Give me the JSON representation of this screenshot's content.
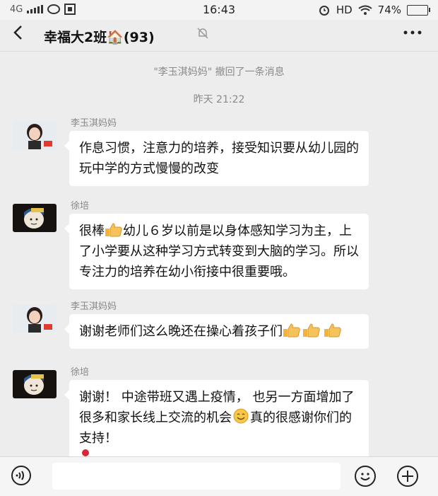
{
  "status_bar": {
    "network": "4G",
    "time": "16:43",
    "hd": "HD",
    "battery_text": "74%",
    "battery_level": 0.74
  },
  "header": {
    "title": "幸福大2班🏠(93)"
  },
  "chat": {
    "recall_notice": "\"李玉淇妈妈\" 撤回了一条消息",
    "timestamp": "昨天 21:22",
    "messages": [
      {
        "sender": "李玉淇妈妈",
        "text": "作息习惯，注意力的培养，接受知识要从幼儿园的玩中学的方式慢慢的改变"
      },
      {
        "sender": "徐培",
        "text_before": "很棒",
        "text_after": "幼儿６岁以前是以身体感知学习为主，上了小学要从这种学习方式转变到大脑的学习。所以专注力的培养在幼小衔接中很重要哦。"
      },
      {
        "sender": "李玉淇妈妈",
        "text": "谢谢老师们这么晚还在操心着孩子们"
      },
      {
        "sender": "徐培",
        "text_before": "谢谢！ 中途带班又遇上疫情， 也另一方面增加了很多和家长线上交流的机会",
        "text_after": "真的很感谢你们的支持！"
      }
    ]
  },
  "icons": [
    "back-icon",
    "mute-icon",
    "more-icon",
    "voice-icon",
    "emoji-icon",
    "plus-icon",
    "thumbs-up-icon",
    "smile-emoji-icon",
    "rose-icon"
  ],
  "colors": {
    "background": "#ededed",
    "bubble": "#ffffff",
    "system_text": "#8a8a8a",
    "sender_text": "#888888"
  }
}
